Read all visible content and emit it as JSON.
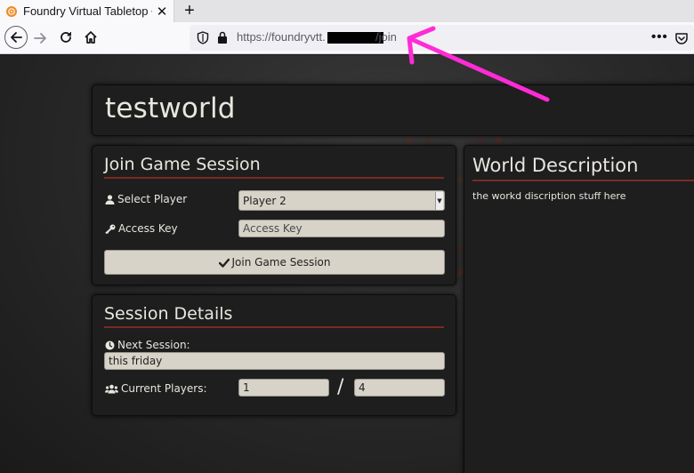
{
  "browser": {
    "tab_title": "Foundry Virtual Tabletop •",
    "tab_close": "✕",
    "new_tab": "+",
    "url_prefix": "https://foundryvtt.",
    "url_path": "/join",
    "menu_dots": "•••"
  },
  "world": {
    "title": "testworld"
  },
  "join": {
    "heading": "Join Game Session",
    "select_player_label": "Select Player",
    "select_player_value": "Player 2",
    "access_key_label": "Access Key",
    "access_key_placeholder": "Access Key",
    "join_button_label": "Join Game Session"
  },
  "session": {
    "heading": "Session Details",
    "next_session_label": "Next Session:",
    "next_session_value": "this friday",
    "current_players_label": "Current Players:",
    "current_players": "1",
    "max_players": "4",
    "separator": "/"
  },
  "description": {
    "heading": "World Description",
    "text": "the workd discription stuff here"
  },
  "colors": {
    "accent_rule": "#7a2a22",
    "annotation_arrow": "#ff2bd6",
    "panel_bg": "#1e1e1e"
  }
}
